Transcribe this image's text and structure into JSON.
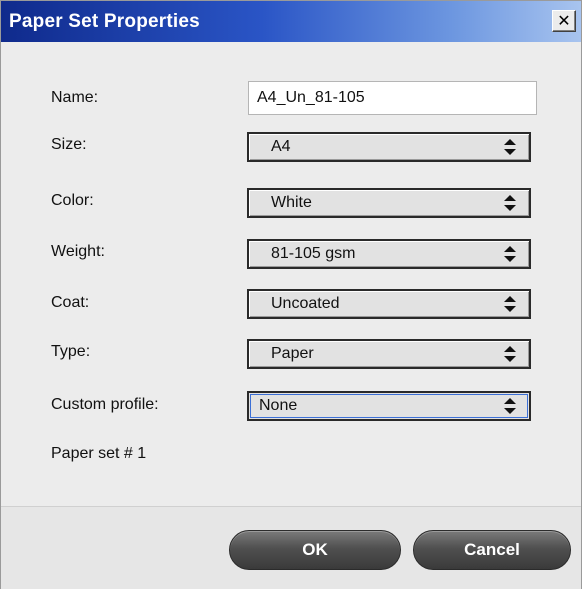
{
  "window": {
    "title": "Paper Set Properties",
    "close_glyph": "✕"
  },
  "form": {
    "name_label": "Name:",
    "name_value": "A4_Un_81-105",
    "size_label": "Size:",
    "size_value": "A4",
    "color_label": "Color:",
    "color_value": "White",
    "weight_label": "Weight:",
    "weight_value": "81-105 gsm",
    "coat_label": "Coat:",
    "coat_value": "Uncoated",
    "type_label": "Type:",
    "type_value": "Paper",
    "custom_profile_label": "Custom profile:",
    "custom_profile_value": "None",
    "paper_set_text": "Paper set # 1"
  },
  "footer": {
    "ok_label": "OK",
    "cancel_label": "Cancel"
  },
  "icons": {
    "select_arrows": "up-down-arrows-icon",
    "close": "close-icon"
  },
  "colors": {
    "titlebar_start": "#0f2a8c",
    "titlebar_end": "#a8c4ef",
    "button_fill": "#505050"
  }
}
